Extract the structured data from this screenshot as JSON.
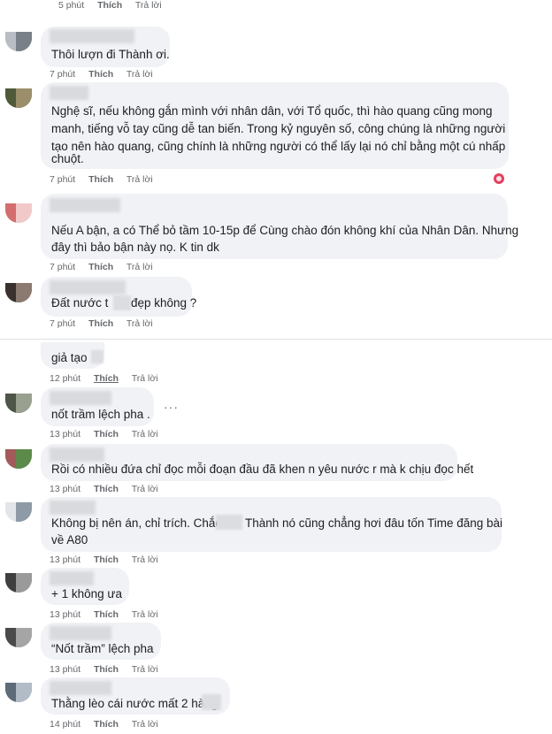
{
  "actions": {
    "like": "Thích",
    "reply": "Trả lời"
  },
  "comments": [
    {
      "time": "5 phút",
      "lines": []
    },
    {
      "time": "7 phút",
      "lines": [
        "Thôi lượn đi Thành ơi."
      ]
    },
    {
      "time": "7 phút",
      "lines": [
        "Nghệ sĩ, nếu không gắn mình với nhân dân, với Tổ quốc, thì hào quang cũng mong",
        "manh, tiếng vỗ tay cũng dễ tan biến. Trong kỷ nguyên số, công chúng là những người",
        "tạo nên hào quang, cũng chính là những người có thể lấy lại nó chỉ bằng một cú nhấp",
        "chuột."
      ]
    },
    {
      "time": "7 phút",
      "lines": [
        "Nếu A bận, a có Thể bỏ tầm 10-15p để Cùng chào đón không khí của Nhân Dân. Nhưng",
        "đây thì bảo bận này nọ. K tin dk"
      ]
    },
    {
      "time": "7 phút",
      "lines": [
        "Đất nước t",
        "đẹp không ?"
      ]
    },
    {
      "time": "12 phút",
      "lines": [
        "giả tạo"
      ]
    },
    {
      "time": "13 phút",
      "lines": [
        "nốt trầm lệch pha ."
      ]
    },
    {
      "time": "13 phút",
      "lines": [
        "Rồi có nhiều đứa chỉ đọc mỗi đoạn đầu đã khen n yêu nước r mà k chịu đọc hết"
      ]
    },
    {
      "time": "13 phút",
      "lines": [
        "Không bị nên án, chỉ trích. Chắc",
        "Thành nó cũng chẳng hơi đâu tốn Time đăng bài",
        "về A80"
      ]
    },
    {
      "time": "13 phút",
      "lines": [
        "+ 1 không ưa"
      ]
    },
    {
      "time": "13 phút",
      "lines": [
        "“Nốt trầm” lệch pha"
      ]
    },
    {
      "time": "14 phút",
      "lines": [
        "Thằng lèo cái nước mất 2 hàng"
      ]
    }
  ],
  "more_icon": "more-horizontal-icon",
  "reaction_icon": "love-reaction-icon",
  "colors": {
    "bubble": "#f0f2f5",
    "meta": "#65676b",
    "love": "#e4405f"
  }
}
